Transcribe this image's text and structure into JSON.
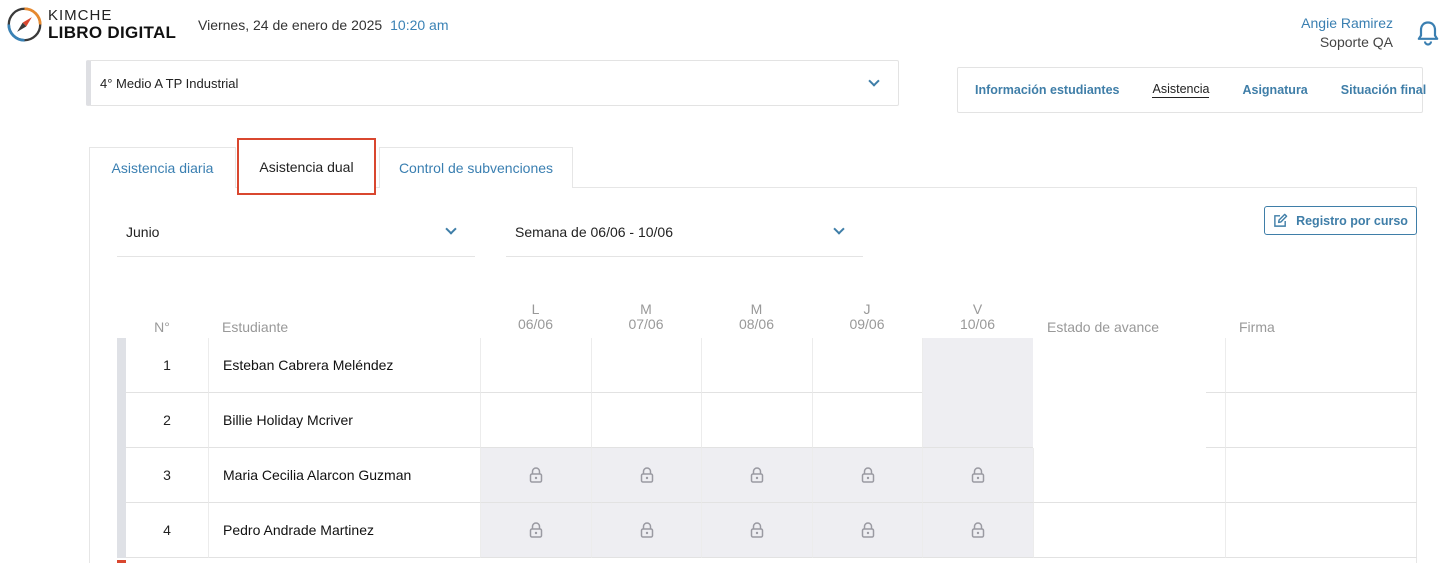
{
  "header": {
    "logo_top": "KIMCHE",
    "logo_bottom": "LIBRO DIGITAL",
    "date": "Viernes, 24 de enero de 2025",
    "time": "10:20 am",
    "user_name": "Angie Ramirez",
    "user_role": "Soporte QA"
  },
  "course_select": {
    "value": "4° Medio A TP Industrial"
  },
  "main_nav": {
    "items": [
      {
        "label": "Información estudiantes",
        "active": false
      },
      {
        "label": "Asistencia",
        "active": true
      },
      {
        "label": "Asignatura",
        "active": false
      },
      {
        "label": "Situación final",
        "active": false
      }
    ]
  },
  "sub_tabs": [
    {
      "label": "Asistencia diaria",
      "active": false
    },
    {
      "label": "Asistencia dual",
      "active": true
    },
    {
      "label": "Control de subvenciones",
      "active": false
    }
  ],
  "filters": {
    "month": "Junio",
    "week": "Semana de 06/06 - 10/06",
    "register_button": "Registro por curso"
  },
  "table": {
    "headers": {
      "number": "N°",
      "student": "Estudiante",
      "progress": "Estado de avance",
      "signature": "Firma"
    },
    "days": [
      {
        "letter": "L",
        "date": "06/06"
      },
      {
        "letter": "M",
        "date": "07/06"
      },
      {
        "letter": "M",
        "date": "08/06"
      },
      {
        "letter": "J",
        "date": "09/06"
      },
      {
        "letter": "V",
        "date": "10/06"
      }
    ],
    "rows": [
      {
        "number": "1",
        "name": "Esteban Cabrera Meléndez",
        "locked": false
      },
      {
        "number": "2",
        "name": "Billie Holiday Mcriver",
        "locked": false
      },
      {
        "number": "3",
        "name": "Maria Cecilia Alarcon Guzman",
        "locked": true
      },
      {
        "number": "4",
        "name": "Pedro Andrade Martinez",
        "locked": true
      }
    ]
  },
  "colors": {
    "accent": "#3f7ea8",
    "highlight_box": "#d9472f",
    "locked_cell_bg": "#eeeef2"
  },
  "icons": {
    "logo": "compass-icon",
    "bell": "bell-icon",
    "register_button": "edit-icon",
    "locked_cell": "lock-icon"
  }
}
